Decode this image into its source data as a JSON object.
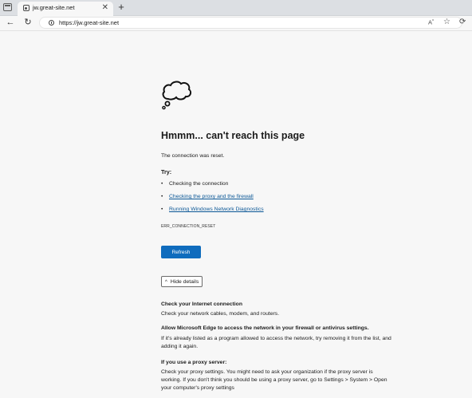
{
  "browser": {
    "tab_title": "jw.great-site.net",
    "tab_close": "✕",
    "new_tab": "+",
    "url": "https://jw.great-site.net",
    "read_aloud": "A",
    "read_aloud_sup": "ᵃ",
    "favorite": "☆",
    "back": "←",
    "refresh": "↻",
    "refresh_alt": "⟳"
  },
  "icons": {
    "tab_actions": "tab-actions-icon",
    "favicon": "site-favicon-icon",
    "site_info": "info-icon",
    "error_cloud": "thought-cloud-icon"
  },
  "error_page": {
    "heading": "Hmmm... can't reach this page",
    "message": "The connection was reset.",
    "try_label": "Try:",
    "suggestions": [
      {
        "text": "Checking the connection",
        "link": false
      },
      {
        "text": "Checking the proxy and the firewall",
        "link": true
      },
      {
        "text": "Running Windows Network Diagnostics",
        "link": true
      }
    ],
    "error_code": "ERR_CONNECTION_RESET",
    "refresh_label": "Refresh",
    "details_toggle_icon": "^",
    "details_toggle_label": "Hide details",
    "details": [
      {
        "heading": "Check your Internet connection",
        "lines": [
          "Check your network cables, modem, and routers."
        ]
      },
      {
        "heading": "Allow Microsoft Edge to access the network in your firewall or antivirus settings.",
        "lines": [
          "If it's already listed as a program allowed to access the network, try removing it from the list, and",
          "adding it again."
        ]
      },
      {
        "heading": "If you use a proxy server:",
        "lines": [
          "Check your proxy settings. You might need to ask your organization if the proxy server is",
          "working. If you don't think you should be using a proxy server, go to Settings > System > Open",
          "your computer's proxy settings"
        ]
      }
    ]
  },
  "colors": {
    "accent": "#0f6cbd",
    "link": "#0b5796",
    "page_bg": "#f7f7f7"
  }
}
